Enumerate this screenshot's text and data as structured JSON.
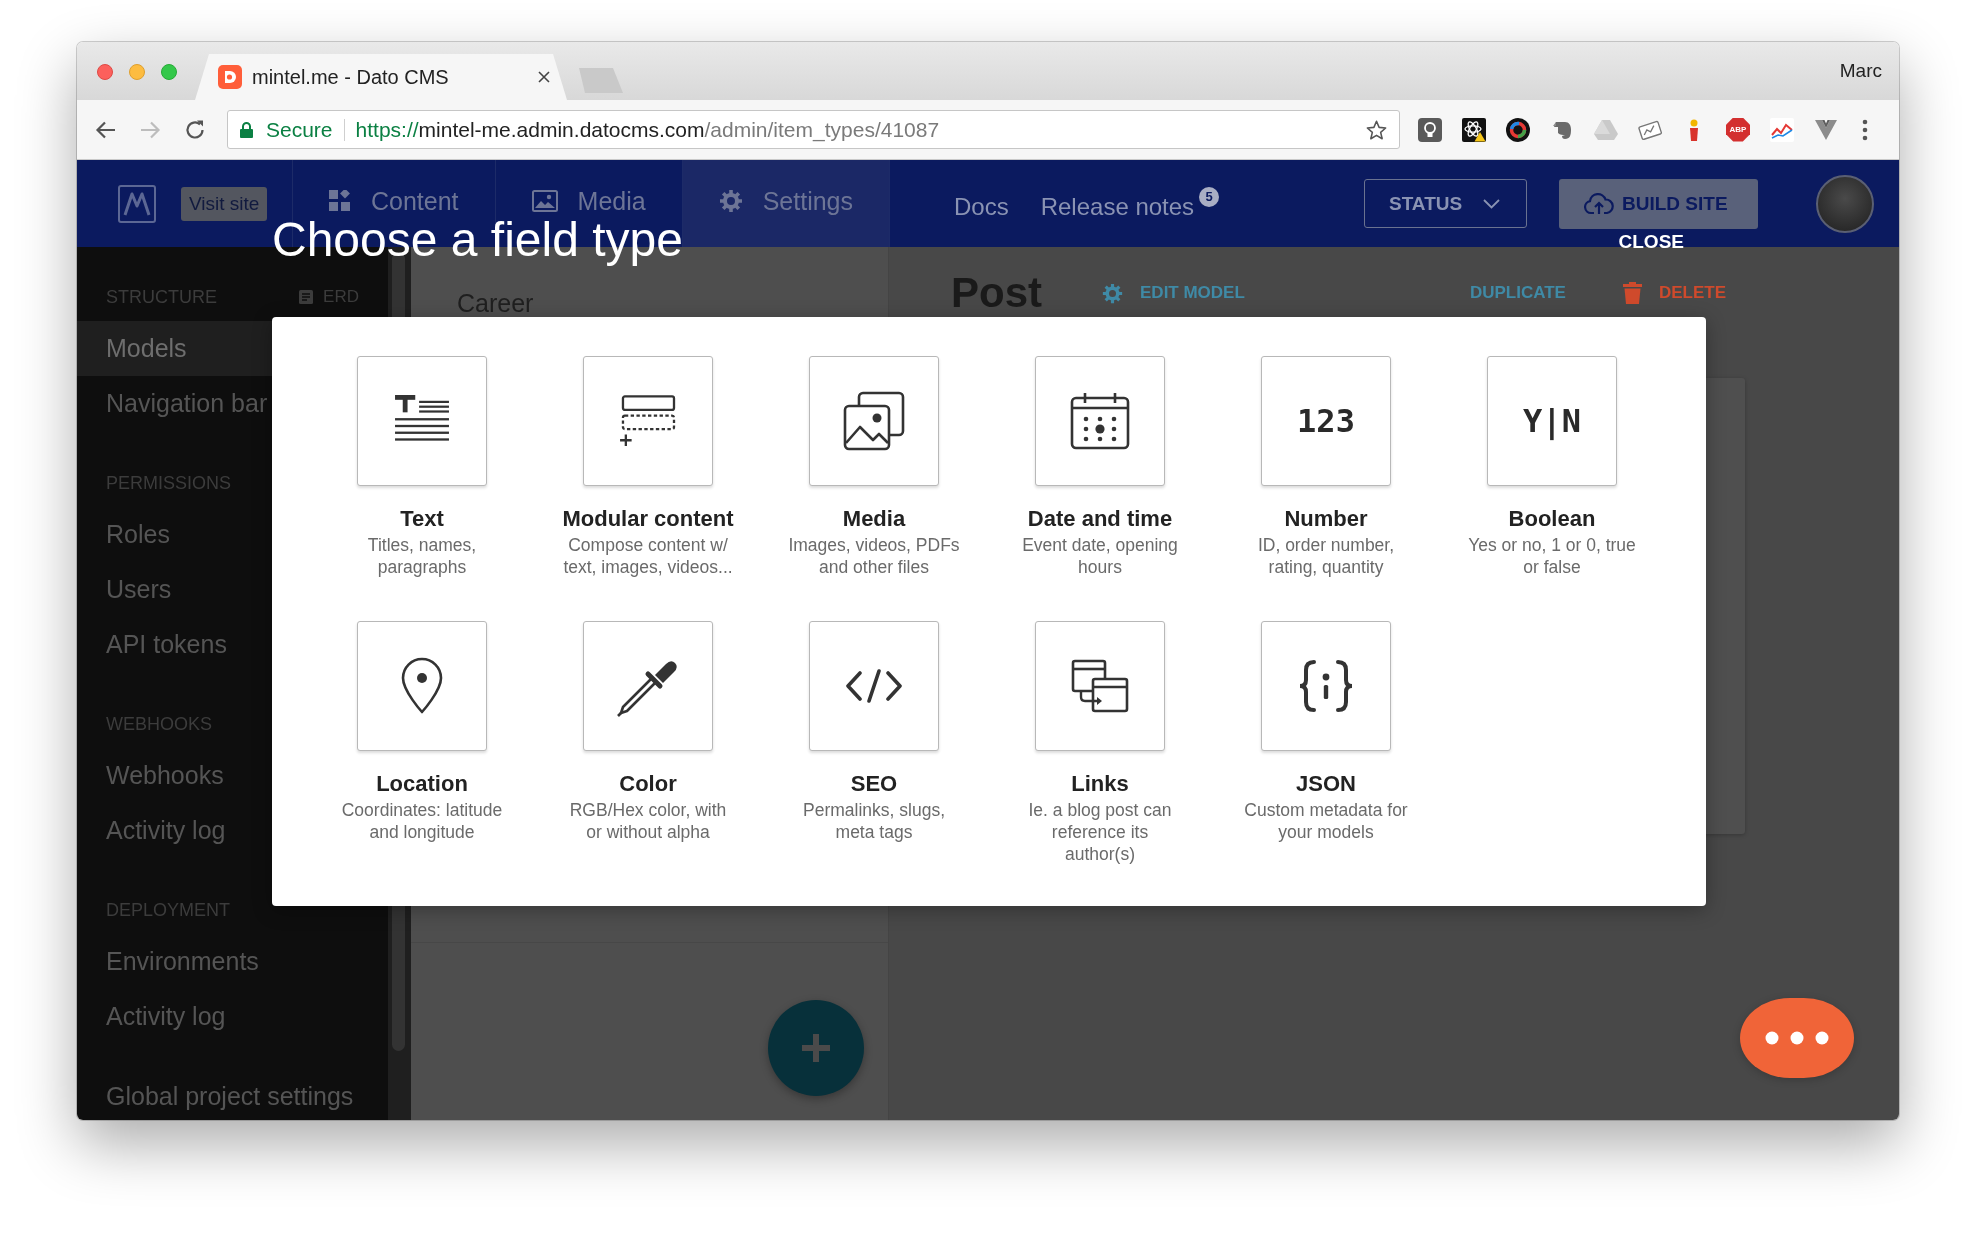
{
  "browser": {
    "tab_title": "mintel.me - Dato CMS",
    "profile": "Marc",
    "secure_label": "Secure",
    "url": {
      "scheme": "https://",
      "host": "mintel-me.admin.datocms.com",
      "path": "/admin/item_types/41087"
    },
    "adblock_label": "ABP"
  },
  "header": {
    "visit_site": "Visit site",
    "nav": [
      {
        "label": "Content",
        "selected": false
      },
      {
        "label": "Media",
        "selected": false
      },
      {
        "label": "Settings",
        "selected": true
      }
    ],
    "links": [
      {
        "label": "Docs"
      },
      {
        "label": "Release notes",
        "badge": "5"
      }
    ],
    "status_button": "STATUS",
    "build_button": "BUILD SITE"
  },
  "sidebar": {
    "sections": [
      {
        "heading": "STRUCTURE",
        "action": "ERD",
        "items": [
          {
            "label": "Models",
            "selected": true
          },
          {
            "label": "Navigation bar",
            "selected": false
          }
        ]
      },
      {
        "heading": "PERMISSIONS",
        "items": [
          {
            "label": "Roles",
            "selected": false
          },
          {
            "label": "Users",
            "selected": false
          },
          {
            "label": "API tokens",
            "selected": false
          }
        ]
      },
      {
        "heading": "WEBHOOKS",
        "items": [
          {
            "label": "Webhooks",
            "selected": false
          },
          {
            "label": "Activity log",
            "selected": false
          }
        ]
      },
      {
        "heading": "DEPLOYMENT",
        "items": [
          {
            "label": "Environments",
            "selected": false
          },
          {
            "label": "Activity log",
            "selected": false
          }
        ]
      }
    ],
    "footer_link": "Global project settings"
  },
  "model_list": {
    "items": [
      {
        "label": "Career"
      }
    ]
  },
  "model": {
    "title": "Post",
    "actions": [
      {
        "label": "EDIT MODEL",
        "kind": "edit"
      },
      {
        "label": "DUPLICATE",
        "kind": "duplicate"
      },
      {
        "label": "DELETE",
        "kind": "delete"
      }
    ]
  },
  "dialog": {
    "title": "Choose a field type",
    "close": "CLOSE",
    "field_types": [
      {
        "kind": "icon",
        "name": "Text",
        "description": "Titles, names,\nparagraphs"
      },
      {
        "kind": "icon",
        "name": "Modular content",
        "description": "Compose content w/\ntext, images, videos..."
      },
      {
        "kind": "icon",
        "name": "Media",
        "description": "Images, videos, PDFs\nand other files"
      },
      {
        "kind": "icon",
        "name": "Date and time",
        "description": "Event date, opening\nhours"
      },
      {
        "kind": "glyph",
        "glyph": "123",
        "name": "Number",
        "description": "ID, order number,\nrating, quantity"
      },
      {
        "kind": "glyph",
        "glyph": "Y|N",
        "name": "Boolean",
        "description": "Yes or no, 1 or 0, true\nor false"
      },
      {
        "kind": "icon",
        "name": "Location",
        "description": "Coordinates: latitude\nand longitude"
      },
      {
        "kind": "icon",
        "name": "Color",
        "description": "RGB/Hex color, with\nor without alpha"
      },
      {
        "kind": "icon",
        "name": "SEO",
        "description": "Permalinks, slugs,\nmeta tags"
      },
      {
        "kind": "icon",
        "name": "Links",
        "description": "Ie. a blog post can\nreference its\nauthor(s)"
      },
      {
        "kind": "icon",
        "name": "JSON",
        "description": "Custom metadata for\nyour models"
      }
    ]
  }
}
